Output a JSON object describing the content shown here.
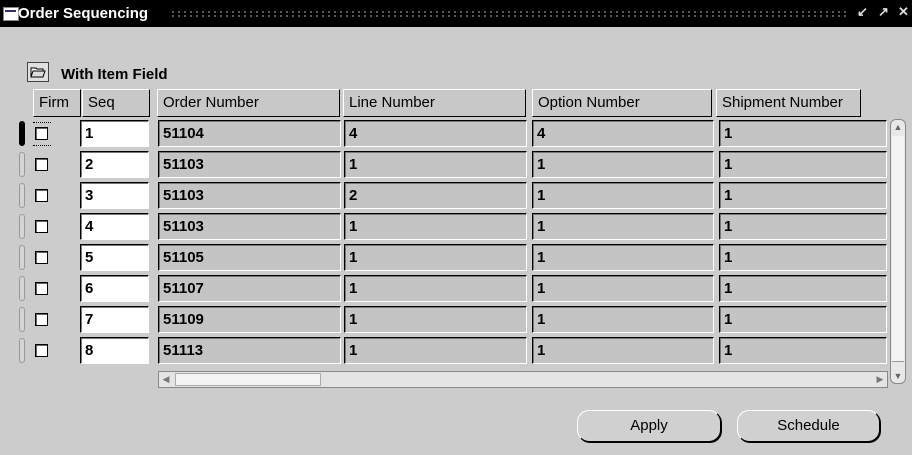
{
  "window": {
    "title": "Order Sequencing",
    "controls": [
      "↙",
      "↗",
      "✕"
    ]
  },
  "block": {
    "title": "With Item Field",
    "icon": "folder-open-icon"
  },
  "columns": {
    "firm": "Firm",
    "seq": "Seq",
    "order_number": "Order Number",
    "line_number": "Line Number",
    "option_number": "Option Number",
    "shipment_number": "Shipment Number"
  },
  "rows": [
    {
      "firm": false,
      "seq": "1",
      "order_number": "51104",
      "line_number": "4",
      "option_number": "4",
      "shipment_number": "1"
    },
    {
      "firm": false,
      "seq": "2",
      "order_number": "51103",
      "line_number": "1",
      "option_number": "1",
      "shipment_number": "1"
    },
    {
      "firm": false,
      "seq": "3",
      "order_number": "51103",
      "line_number": "2",
      "option_number": "1",
      "shipment_number": "1"
    },
    {
      "firm": false,
      "seq": "4",
      "order_number": "51103",
      "line_number": "1",
      "option_number": "1",
      "shipment_number": "1"
    },
    {
      "firm": false,
      "seq": "5",
      "order_number": "51105",
      "line_number": "1",
      "option_number": "1",
      "shipment_number": "1"
    },
    {
      "firm": false,
      "seq": "6",
      "order_number": "51107",
      "line_number": "1",
      "option_number": "1",
      "shipment_number": "1"
    },
    {
      "firm": false,
      "seq": "7",
      "order_number": "51109",
      "line_number": "1",
      "option_number": "1",
      "shipment_number": "1"
    },
    {
      "firm": false,
      "seq": "8",
      "order_number": "51113",
      "line_number": "1",
      "option_number": "1",
      "shipment_number": "1"
    }
  ],
  "buttons": {
    "apply": "Apply",
    "schedule": "Schedule"
  },
  "colors": {
    "background": "#cccccc",
    "titlebar": "#000000",
    "editable": "#ffffff",
    "readonly": "#c4c4c4"
  }
}
